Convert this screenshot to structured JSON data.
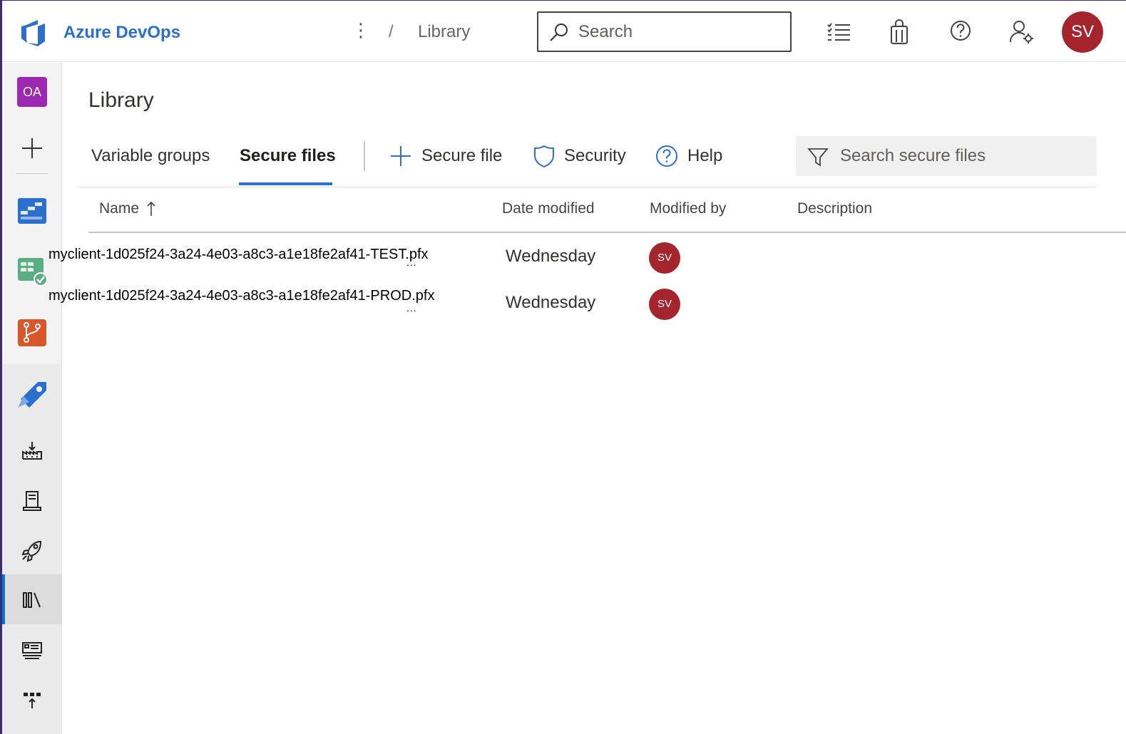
{
  "header": {
    "brand": "Azure DevOps",
    "breadcrumb_separator": "/",
    "breadcrumb": "Library",
    "search_placeholder": "Search",
    "user_initials": "SV"
  },
  "leftnav": {
    "org_initials": "OA",
    "icons": [
      "add-icon",
      "overview-icon",
      "boards-icon",
      "repos-icon",
      "pipelines-icon",
      "builds-icon",
      "environments-icon",
      "releases-icon",
      "library-icon",
      "task-groups-icon",
      "deployment-groups-icon"
    ],
    "active": "library-icon"
  },
  "page": {
    "title": "Library",
    "tabs": [
      {
        "label": "Variable groups",
        "active": false
      },
      {
        "label": "Secure files",
        "active": true
      }
    ],
    "commands": {
      "add_secure_file": "Secure file",
      "security": "Security",
      "help": "Help"
    },
    "filter_placeholder": "Search secure files"
  },
  "table": {
    "columns": [
      "Name",
      "Date modified",
      "Modified by",
      "Description"
    ],
    "sort": "ascending",
    "rows": [
      {
        "name": "myclient-1d025f24-3a24-4e03-a8c3-a1e18fe2af41-TEST.pfx",
        "more": "...",
        "date": "Wednesday",
        "modified_by": "SV",
        "description": ""
      },
      {
        "name": "myclient-1d025f24-3a24-4e03-a8c3-a1e18fe2af41-PROD.pfx",
        "more": "...",
        "date": "Wednesday",
        "modified_by": "SV",
        "description": ""
      }
    ]
  },
  "colors": {
    "accent": "#2b6fcf",
    "avatar": "#a4262c",
    "org": "#9c27b0",
    "frame": "#3b2a74"
  }
}
